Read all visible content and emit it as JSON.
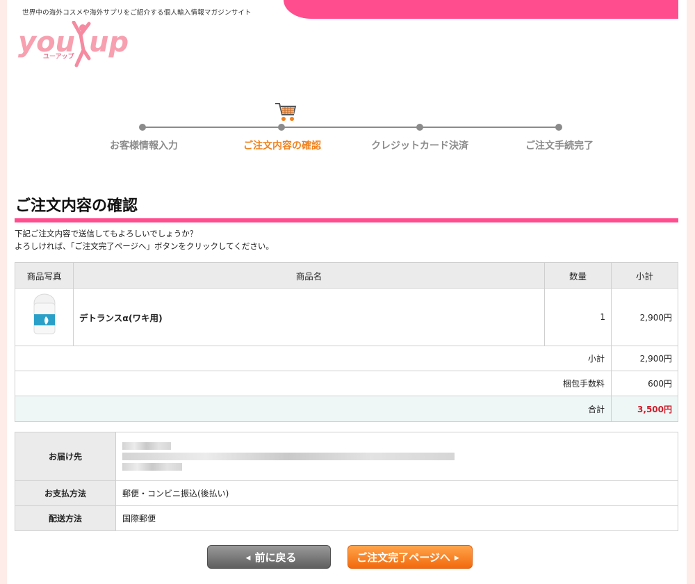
{
  "header": {
    "tagline": "世界中の海外コスメや海外サプリをご紹介する個人輸入情報マガジンサイト",
    "logo_text": "you up",
    "logo_sub": "ユーアップ"
  },
  "steps": [
    {
      "label": "お客様情報入力",
      "active": false
    },
    {
      "label": "ご注文内容の確認",
      "active": true
    },
    {
      "label": "クレジットカード決済",
      "active": false
    },
    {
      "label": "ご注文手続完了",
      "active": false
    }
  ],
  "page": {
    "title": "ご注文内容の確認",
    "intro_line1": "下記ご注文内容で送信してもよろしいでしょうか？",
    "intro_line2": "よろしければ、「ご注文完了ページへ」ボタンをクリックしてください。"
  },
  "order_table": {
    "headers": {
      "photo": "商品写真",
      "name": "商品名",
      "qty": "数量",
      "subtotal": "小計"
    },
    "items": [
      {
        "name": "デトランスα(ワキ用)",
        "qty": "1",
        "subtotal": "2,900円"
      }
    ],
    "summary": {
      "subtotal_label": "小計",
      "subtotal_value": "2,900円",
      "packing_label": "梱包手数料",
      "packing_value": "600円",
      "total_label": "合計",
      "total_value": "3,500円"
    }
  },
  "info_table": {
    "delivery_label": "お届け先",
    "payment_label": "お支払方法",
    "payment_value": "郵便・コンビニ振込(後払い)",
    "shipping_label": "配送方法",
    "shipping_value": "国際郵便"
  },
  "buttons": {
    "back": "前に戻る",
    "next": "ご注文完了ページへ"
  },
  "colors": {
    "brand_pink": "#ff4d8d",
    "active_step": "#f0821e",
    "total_red": "#cc1e2b",
    "next_button": "#f26a0d",
    "back_button": "#5f5f5f"
  }
}
